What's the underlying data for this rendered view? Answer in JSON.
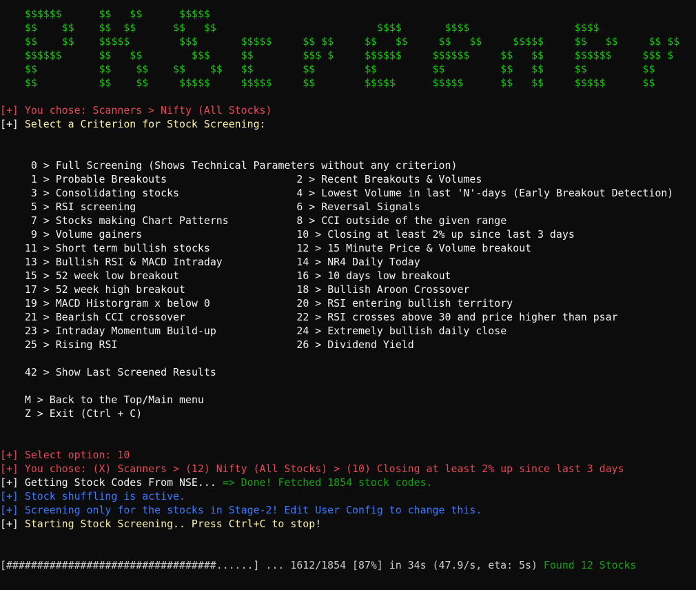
{
  "window": {
    "app": "PKScreener terminal"
  },
  "banner": {
    "lines": [
      "    $$$$$$      $$   $$      $$$$$",
      "    $$    $$    $$  $$      $$   $$                          $$$$       $$$$                 $$$$",
      "    $$    $$    $$$$$        $$$       $$$$$     $$ $$     $$   $$     $$   $$     $$$$$     $$   $$     $$ $$",
      "    $$$$$$      $$   $$        $$$     $$        $$$ $     $$$$$$     $$$$$$     $$   $$     $$$$$$     $$$ $",
      "    $$          $$    $$    $$    $$   $$        $$        $$         $$         $$   $$     $$         $$",
      "    $$          $$    $$     $$$$$     $$$$$     $$        $$$$$      $$$$$      $$   $$     $$$$$      $$"
    ]
  },
  "header": {
    "you_chose_prefix": "[+] ",
    "you_chose": "You chose: Scanners > Nifty (All Stocks)",
    "select_prefix": "[+] ",
    "select_criterion": "Select a Criterion for Stock Screening:"
  },
  "menu": {
    "full_row": {
      "key": "0",
      "label": "Full Screening (Shows Technical Parameters without any criterion)"
    },
    "rows": [
      {
        "left": {
          "key": "1",
          "label": "Probable Breakouts"
        },
        "right": {
          "key": "2",
          "label": "Recent Breakouts & Volumes"
        }
      },
      {
        "left": {
          "key": "3",
          "label": "Consolidating stocks"
        },
        "right": {
          "key": "4",
          "label": "Lowest Volume in last 'N'-days (Early Breakout Detection)"
        }
      },
      {
        "left": {
          "key": "5",
          "label": "RSI screening"
        },
        "right": {
          "key": "6",
          "label": "Reversal Signals"
        }
      },
      {
        "left": {
          "key": "7",
          "label": "Stocks making Chart Patterns"
        },
        "right": {
          "key": "8",
          "label": "CCI outside of the given range"
        }
      },
      {
        "left": {
          "key": "9",
          "label": "Volume gainers"
        },
        "right": {
          "key": "10",
          "label": "Closing at least 2% up since last 3 days"
        }
      },
      {
        "left": {
          "key": "11",
          "label": "Short term bullish stocks"
        },
        "right": {
          "key": "12",
          "label": "15 Minute Price & Volume breakout"
        }
      },
      {
        "left": {
          "key": "13",
          "label": "Bullish RSI & MACD Intraday"
        },
        "right": {
          "key": "14",
          "label": "NR4 Daily Today"
        }
      },
      {
        "left": {
          "key": "15",
          "label": "52 week low breakout"
        },
        "right": {
          "key": "16",
          "label": "10 days low breakout"
        }
      },
      {
        "left": {
          "key": "17",
          "label": "52 week high breakout"
        },
        "right": {
          "key": "18",
          "label": "Bullish Aroon Crossover"
        }
      },
      {
        "left": {
          "key": "19",
          "label": "MACD Historgram x below 0"
        },
        "right": {
          "key": "20",
          "label": "RSI entering bullish territory"
        }
      },
      {
        "left": {
          "key": "21",
          "label": "Bearish CCI crossover"
        },
        "right": {
          "key": "22",
          "label": "RSI crosses above 30 and price higher than psar"
        }
      },
      {
        "left": {
          "key": "23",
          "label": "Intraday Momentum Build-up"
        },
        "right": {
          "key": "24",
          "label": "Extremely bullish daily close"
        }
      },
      {
        "left": {
          "key": "25",
          "label": "Rising RSI"
        },
        "right": {
          "key": "26",
          "label": "Dividend Yield"
        }
      }
    ],
    "last_results": {
      "key": "42",
      "label": "Show Last Screened Results"
    },
    "back": {
      "key": "M",
      "label": "Back to the Top/Main menu"
    },
    "exit": {
      "key": "Z",
      "label": "Exit (Ctrl + C)"
    },
    "separator": " > "
  },
  "log": {
    "prefix": "[+] ",
    "select_option": "Select option: 10",
    "you_chose_full": "You chose: (X) Scanners > (12) Nifty (All Stocks) > (10) Closing at least 2% up since last 3 days",
    "getting_codes": "Getting Stock Codes From NSE... ",
    "fetched": "=> Done! Fetched 1854 stock codes.",
    "shuffling": "Stock shuffling is active.",
    "stage2": "Screening only for the stocks in Stage-2! Edit User Config to change this.",
    "starting": "Starting Stock Screening.. Press Ctrl+C to stop!"
  },
  "progress": {
    "bar": "[##################################......]",
    "current": 1612,
    "total": 1854,
    "percent": 87,
    "stats": " ... 1612/1854 [87%] in 34s (47.9/s, eta: 5s) ",
    "found": "Found 12 Stocks"
  },
  "colors": {
    "background": "#0c0c0c",
    "banner_green": "#16c60c",
    "success_green": "#13a10e",
    "error_red": "#e74856",
    "info_blue": "#3b78ff",
    "prompt_yellow": "#f9f1a5",
    "text_white": "#f2f2f2",
    "text_gray": "#cccccc"
  }
}
